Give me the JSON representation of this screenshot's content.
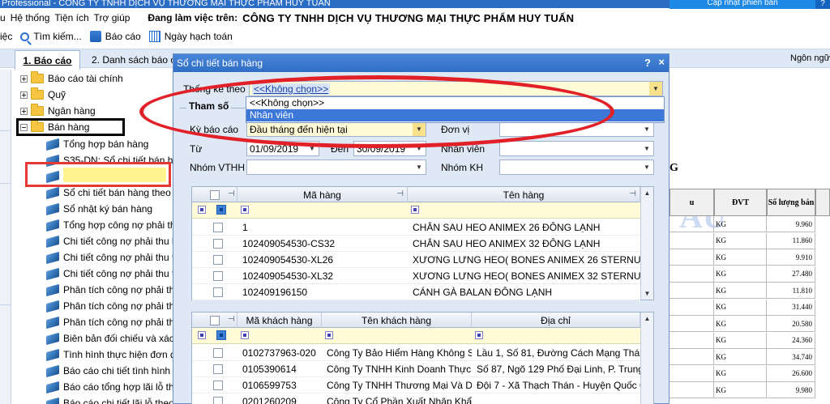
{
  "titlebar": {
    "title": "Professional - CÔNG TY TNHH DỊCH VỤ THƯƠNG MẠI THỰC PHẨM HUY TUẤN",
    "update_label": "Cập nhật phiên bản",
    "extra": "?"
  },
  "menu": {
    "items": [
      "u",
      "Hệ thống",
      "Tiện ích",
      "Trợ giúp"
    ],
    "working_label": "Đang làm việc trên:",
    "company": "CÔNG TY TNHH DỊCH VỤ THƯƠNG MẠI THỰC PHẨM HUY TUẤN"
  },
  "toolbar": {
    "items": [
      "iệc",
      "Tìm kiếm...",
      "Báo cáo",
      "Ngày hạch toán"
    ]
  },
  "tabs": {
    "tab1": "1. Báo cáo",
    "tab2": "2. Danh sách báo cáo",
    "language": "Ngôn ngữ/"
  },
  "tree": {
    "folders": [
      "Báo cáo tài chính",
      "Quỹ",
      "Ngân hàng",
      "Bán hàng"
    ],
    "reports": [
      "Tổng hợp bán hàng",
      "S35-DN: Sổ chi tiết bán hàng",
      "Sổ chi tiết bán hàng",
      "Sổ chi tiết bán hàng theo mặt hàng",
      "Sổ nhật ký bán hàng",
      "Tổng hợp công nợ phải thu khách hàng",
      "Chi tiết công nợ phải thu khách hàng",
      "Chi tiết công nợ phải thu theo hóa đơn",
      "Chi tiết công nợ phải thu theo nhân viên",
      "Phân tích công nợ phải thu",
      "Phân tích công nợ phải thu theo tuổi nợ",
      "Phân tích công nợ phải thu quá hạn",
      "Biên bản đối chiếu và xác nhận công nợ",
      "Tình hình thực hiện đơn đặt hàng",
      "Báo cáo chi tiết tình hình thực hiện",
      "Báo cáo tổng hợp lãi lỗ theo",
      "Báo cáo chi tiết lãi lỗ theo"
    ]
  },
  "dialog": {
    "title": "Sổ chi tiết bán hàng",
    "help": "?",
    "close": "×",
    "thongke_label": "Thống kê theo",
    "thongke_value": "<<Không chọn>>",
    "dropdown_options": [
      "<<Không chọn>>",
      "Nhân viên"
    ],
    "thamso_label": "Tham số",
    "kybaocao_label": "Kỳ báo cáo",
    "kybaocao_value": "Đầu tháng đến hiện tại",
    "donvi_label": "Đơn vị",
    "tu_label": "Từ",
    "tu_value": "01/09/2019",
    "den_label": "Đến",
    "den_value": "30/09/2019",
    "nhanvien_label": "Nhân viên",
    "nhomvthh_label": "Nhóm VTHH",
    "nhomkh_label": "Nhóm KH"
  },
  "items_grid": {
    "headers": [
      "Mã hàng",
      "Tên hàng"
    ],
    "rows": [
      [
        "1",
        "CHÂN SAU HEO ANIMEX 26 ĐÔNG LẠNH"
      ],
      [
        "102409054530-CS32",
        "CHÂN SAU HEO ANIMEX 32 ĐÔNG LẠNH"
      ],
      [
        "102409054530-XL26",
        "XƯƠNG LƯNG HEO( BONES ANIMEX 26 STERNUM..."
      ],
      [
        "102409054530-XL32",
        "XƯƠNG LƯNG HEO( BONES ANIMEX 32 STERNUM..."
      ],
      [
        "102409196150",
        "CÁNH GÀ BALAN ĐÔNG LẠNH"
      ]
    ]
  },
  "customers_grid": {
    "headers": [
      "Mã khách hàng",
      "Tên khách hàng",
      "Địa chỉ"
    ],
    "rows": [
      [
        "0102737963-020",
        "Công Ty Bảo Hiểm Hàng Không S...",
        "Lầu 1, Số 81, Đường Cách Mạng Tháng"
      ],
      [
        "0105390614",
        "Công Ty TNHH Kinh Doanh Thực...",
        "Số 87, Ngõ 129 Phố Đại Linh, P. Trung V"
      ],
      [
        "0106599753",
        "Công Ty TNHH Thương Mại Và Dị...",
        "Đội 7 - Xã Thạch Thán - Huyện Quốc Oa"
      ],
      [
        "0201260209",
        "Công Ty Cổ Phần Xuất Nhập Khẩ...",
        ""
      ]
    ]
  },
  "report_bg": {
    "heading_fragment": "G",
    "watermark": "ẤU",
    "headers": [
      "u",
      "ĐVT",
      "Số lượng bán"
    ],
    "units": [
      "KG",
      "KG",
      "KG",
      "KG",
      "KG",
      "KG",
      "KG",
      "KG",
      "KG",
      "KG",
      "KG",
      "KG"
    ],
    "quantities": [
      "9.960",
      "11.860",
      "9.910",
      "27.480",
      "11.810",
      "31.440",
      "20.580",
      "24.360",
      "34.740",
      "26.600",
      "9.980",
      "14.400",
      "45.560"
    ]
  }
}
